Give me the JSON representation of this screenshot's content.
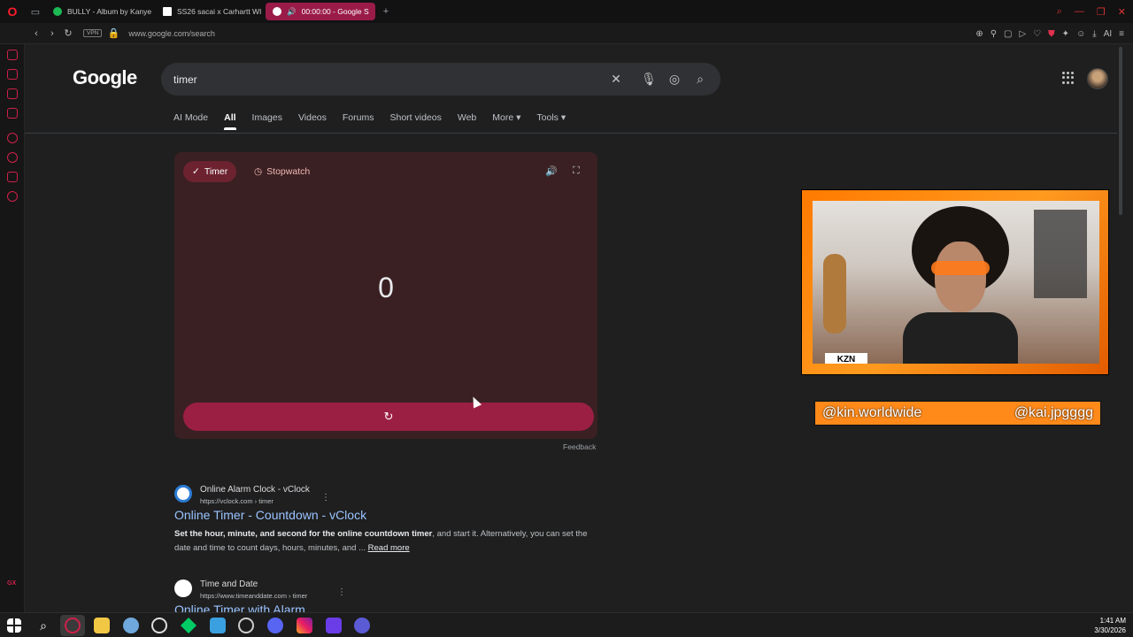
{
  "browser": {
    "tabs": [
      {
        "label": "BULLY - Album by Kanye",
        "color": "#1db954"
      },
      {
        "label": "SS26 sacai x Carhartt WI",
        "color": "#ffffff"
      },
      {
        "label": "00:00:00 - Google S",
        "color": "#ffffff"
      }
    ],
    "url": "www.google.com/search",
    "vpn_label": "VPN",
    "ai_label": "AI"
  },
  "google": {
    "logo": "Google",
    "query": "timer",
    "nav_tabs": [
      "AI Mode",
      "All",
      "Images",
      "Videos",
      "Forums",
      "Short videos",
      "Web",
      "More",
      "Tools"
    ],
    "selected_tab": "All"
  },
  "timer_widget": {
    "timer_label": "Timer",
    "stopwatch_label": "Stopwatch",
    "value": "0",
    "feedback": "Feedback"
  },
  "results": [
    {
      "site": "Online Alarm Clock - vClock",
      "url": "https://vclock.com › timer",
      "title": "Online Timer - Countdown - vClock",
      "snippet_bold": "Set the hour, minute, and second for the online countdown timer",
      "snippet_rest": ", and start it. Alternatively, you can set the date and time to count days, hours, minutes, and ...",
      "read_more": "Read more"
    },
    {
      "site": "Time and Date",
      "url": "https://www.timeanddate.com › timer",
      "title": "Online Timer with Alarm"
    }
  ],
  "overlay": {
    "cam_tag": "KZN",
    "handle_left": "@kin.worldwide",
    "handle_right": "@kai.jpgggg"
  },
  "taskbar": {
    "time": "1:41 AM",
    "date": "3/30/2026"
  }
}
